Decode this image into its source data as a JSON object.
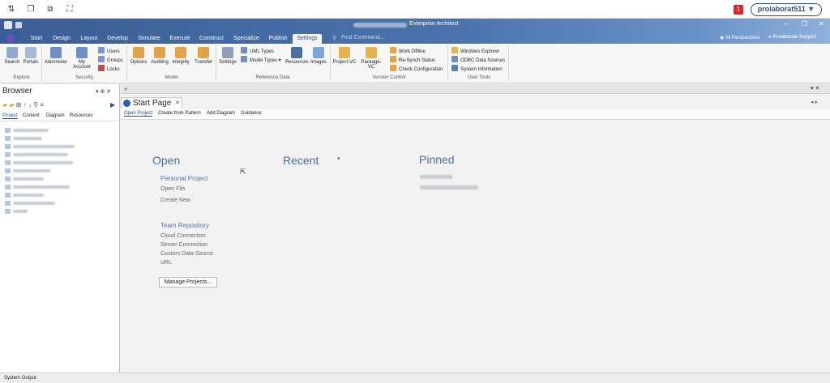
{
  "host": {
    "notification_count": "1",
    "user_button": "prolaborat511 ▼"
  },
  "window": {
    "title": "Enterprise Architect"
  },
  "ribbon": {
    "tabs": [
      "Start",
      "Design",
      "Layout",
      "Develop",
      "Simulate",
      "Execute",
      "Construct",
      "Specialize",
      "Publish",
      "Settings"
    ],
    "active_tab": "Settings",
    "find_command_placeholder": "Find Command...",
    "perspectives": "All Perspectives",
    "support": "Prolaborate Support",
    "explore": {
      "search": "Search",
      "portals": "Portals",
      "label": "Explore"
    },
    "security": {
      "administer": "Administer",
      "my_account": "My Account",
      "users": "Users",
      "groups": "Groups",
      "locks": "Locks",
      "label": "Security"
    },
    "model": {
      "options": "Options",
      "auditing": "Auditing",
      "integrity": "Integrity",
      "transfer": "Transfer",
      "label": "Model"
    },
    "reference": {
      "settings": "Settings",
      "uml_types": "UML Types",
      "model_types": "Model Types",
      "resources": "Resources",
      "images": "Images",
      "label": "Reference Data"
    },
    "version_control": {
      "project_vc": "Project-VC",
      "package_vc": "Package-VC",
      "work_offline": "Work Offline",
      "resynch": "Re-Synch Status",
      "check_config": "Check Configuration",
      "label": "Version Control"
    },
    "user_tools": {
      "windows_explorer": "Windows Explorer",
      "odbc": "ODBC Data Sources",
      "system_info": "System Information",
      "label": "User Tools"
    }
  },
  "browser": {
    "title": "Browser",
    "tabs": [
      "Project",
      "Context",
      "Diagram",
      "Resources"
    ]
  },
  "doc": {
    "tab": "Start Page",
    "subtabs": [
      "Open Project",
      "Create from Pattern",
      "Add Diagram",
      "Guidance"
    ],
    "open": {
      "heading": "Open",
      "personal_heading": "Personal Project",
      "open_file": "Open File",
      "create_new": "Create New",
      "team_heading": "Team Repository",
      "cloud": "Cloud Connection",
      "server": "Server Connection",
      "custom": "Custom Data Source",
      "url": "URL",
      "manage": "Manage Projects..."
    },
    "recent_heading": "Recent",
    "pinned_heading": "Pinned"
  },
  "status": {
    "text": "System Output"
  }
}
